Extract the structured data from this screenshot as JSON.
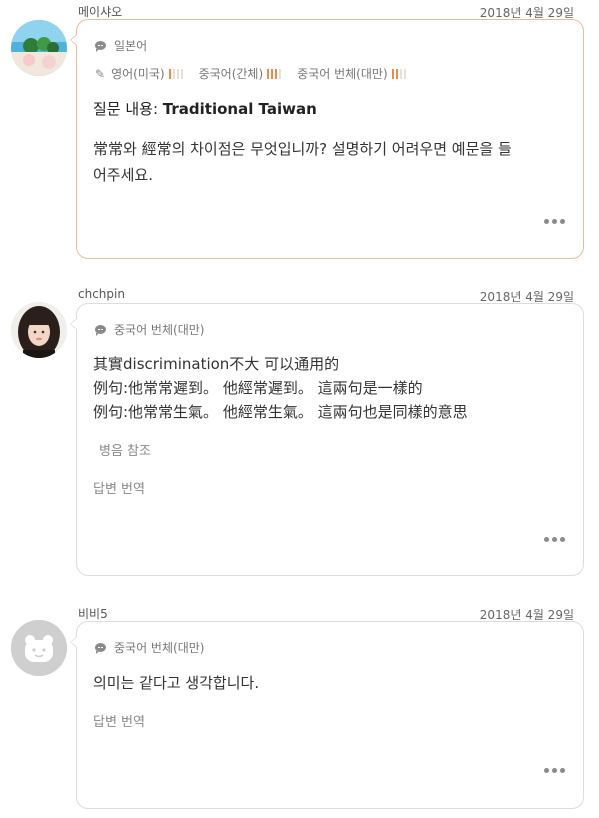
{
  "posts": [
    {
      "username": "메이샤오",
      "date": "2018년 4월 29일",
      "language": "일본어",
      "languages": [
        {
          "name": "영어(미국)",
          "level": 1
        },
        {
          "name": "중국어(간체)",
          "level": 3
        },
        {
          "name": "중국어 번체(대만)",
          "level": 2
        }
      ],
      "title_prefix": "질문 내용: ",
      "title_topic": "Traditional Taiwan",
      "body_line1": "常常와 經常의 차이점은 무엇입니까? 설명하기 어려우면 예문을 들",
      "body_line2": "어주세요."
    },
    {
      "username": "chchpin",
      "date": "2018년 4월 29일",
      "language": "중국어 번체(대만)",
      "lines": [
        "其實discrimination不大 可以通用的",
        "例句:他常常遲到。 他經常遲到。 這兩句是一樣的",
        "例句:他常常生氣。 他經常生氣。 這兩句也是同樣的意思"
      ],
      "pinyin_label": "병음 참조",
      "translate_label": "답변 번역"
    },
    {
      "username": "비비5",
      "date": "2018년 4월 29일",
      "language": "중국어 번체(대만)",
      "body": "의미는 같다고 생각합니다.",
      "translate_label": "답변 번역"
    }
  ],
  "colors": {
    "accent": "#f08a4b",
    "question_border": "#f0b89a",
    "border": "#dcdcdc"
  },
  "icons": [
    "chat-bubble-icon",
    "pencil-icon",
    "more-dots-icon"
  ]
}
